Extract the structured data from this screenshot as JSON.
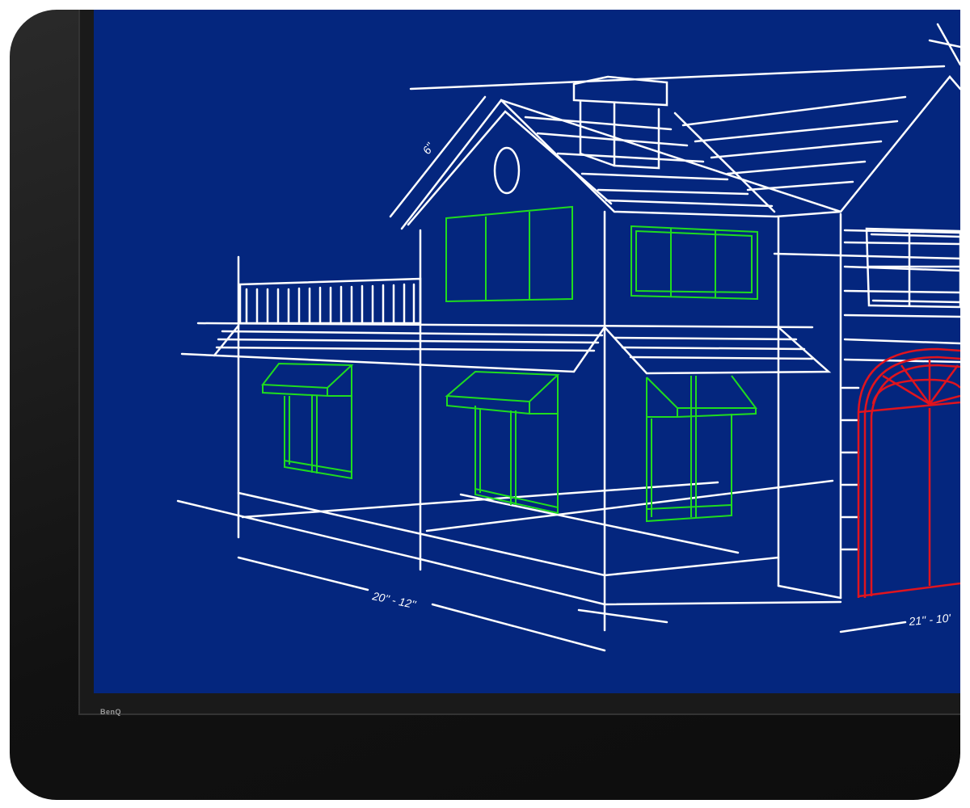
{
  "device": {
    "brand_label": "BenQ"
  },
  "drawing": {
    "dimension_roof": "6''",
    "dimension_left": "20'' - 12''",
    "dimension_right": "21'' - 10'"
  },
  "colors": {
    "screen_background": "#04267e",
    "line_white": "#ffffff",
    "highlight_green": "#1fdc1f",
    "highlight_red": "#e0141e"
  }
}
